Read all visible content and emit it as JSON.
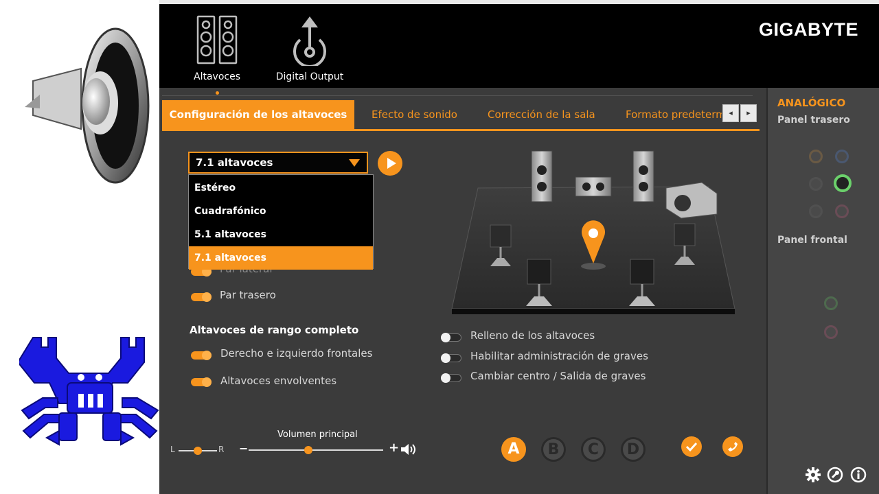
{
  "left_panel": {
    "speaker_icon": "speaker-icon",
    "realtek_logo": "realtek-crab-logo"
  },
  "header": {
    "nav": [
      {
        "label": "Altavoces",
        "icon": "speakers-icon"
      },
      {
        "label": "Digital Output",
        "icon": "digital-output-icon"
      }
    ],
    "brand": "GIGABYTE"
  },
  "tabs": [
    {
      "label": "Configuración de los altavoces",
      "active": true
    },
    {
      "label": "Efecto de sonido",
      "active": false
    },
    {
      "label": "Corrección de la sala",
      "active": false
    },
    {
      "label": "Formato predeterm",
      "active": false
    }
  ],
  "tab_scroll": {
    "prev": "◂",
    "next": "▸"
  },
  "speaker_config": {
    "selected": "7.1 altavoces",
    "options": [
      {
        "label": "Estéreo",
        "selected": false
      },
      {
        "label": "Cuadrafónico",
        "selected": false
      },
      {
        "label": "5.1 altavoces",
        "selected": false
      },
      {
        "label": "7.1 altavoces",
        "selected": true
      }
    ]
  },
  "optional_speakers": [
    {
      "label": "Par lateral",
      "on": true
    },
    {
      "label": "Par trasero",
      "on": true
    }
  ],
  "full_range": {
    "title": "Altavoces de rango completo",
    "items": [
      {
        "label": "Derecho e izquierdo frontales",
        "on": true
      },
      {
        "label": "Altavoces envolventes",
        "on": true
      }
    ]
  },
  "options": [
    {
      "label": "Relleno de los altavoces",
      "on": false
    },
    {
      "label": "Habilitar administración de graves",
      "on": false
    },
    {
      "label": "Cambiar centro / Salida de graves",
      "on": false
    }
  ],
  "balance": {
    "left": "L",
    "right": "R",
    "value": 0.5
  },
  "volume": {
    "label": "Volumen principal",
    "minus": "−",
    "plus": "+",
    "value": 0.45
  },
  "profiles": [
    {
      "label": "A",
      "active": true
    },
    {
      "label": "B",
      "active": false
    },
    {
      "label": "C",
      "active": false
    },
    {
      "label": "D",
      "active": false
    }
  ],
  "right_panel": {
    "title": "ANALÓGICO",
    "back_panel": "Panel trasero",
    "front_panel": "Panel frontal"
  },
  "colors": {
    "accent": "#f7941d",
    "background": "#3b3b3b",
    "header": "#000000"
  }
}
